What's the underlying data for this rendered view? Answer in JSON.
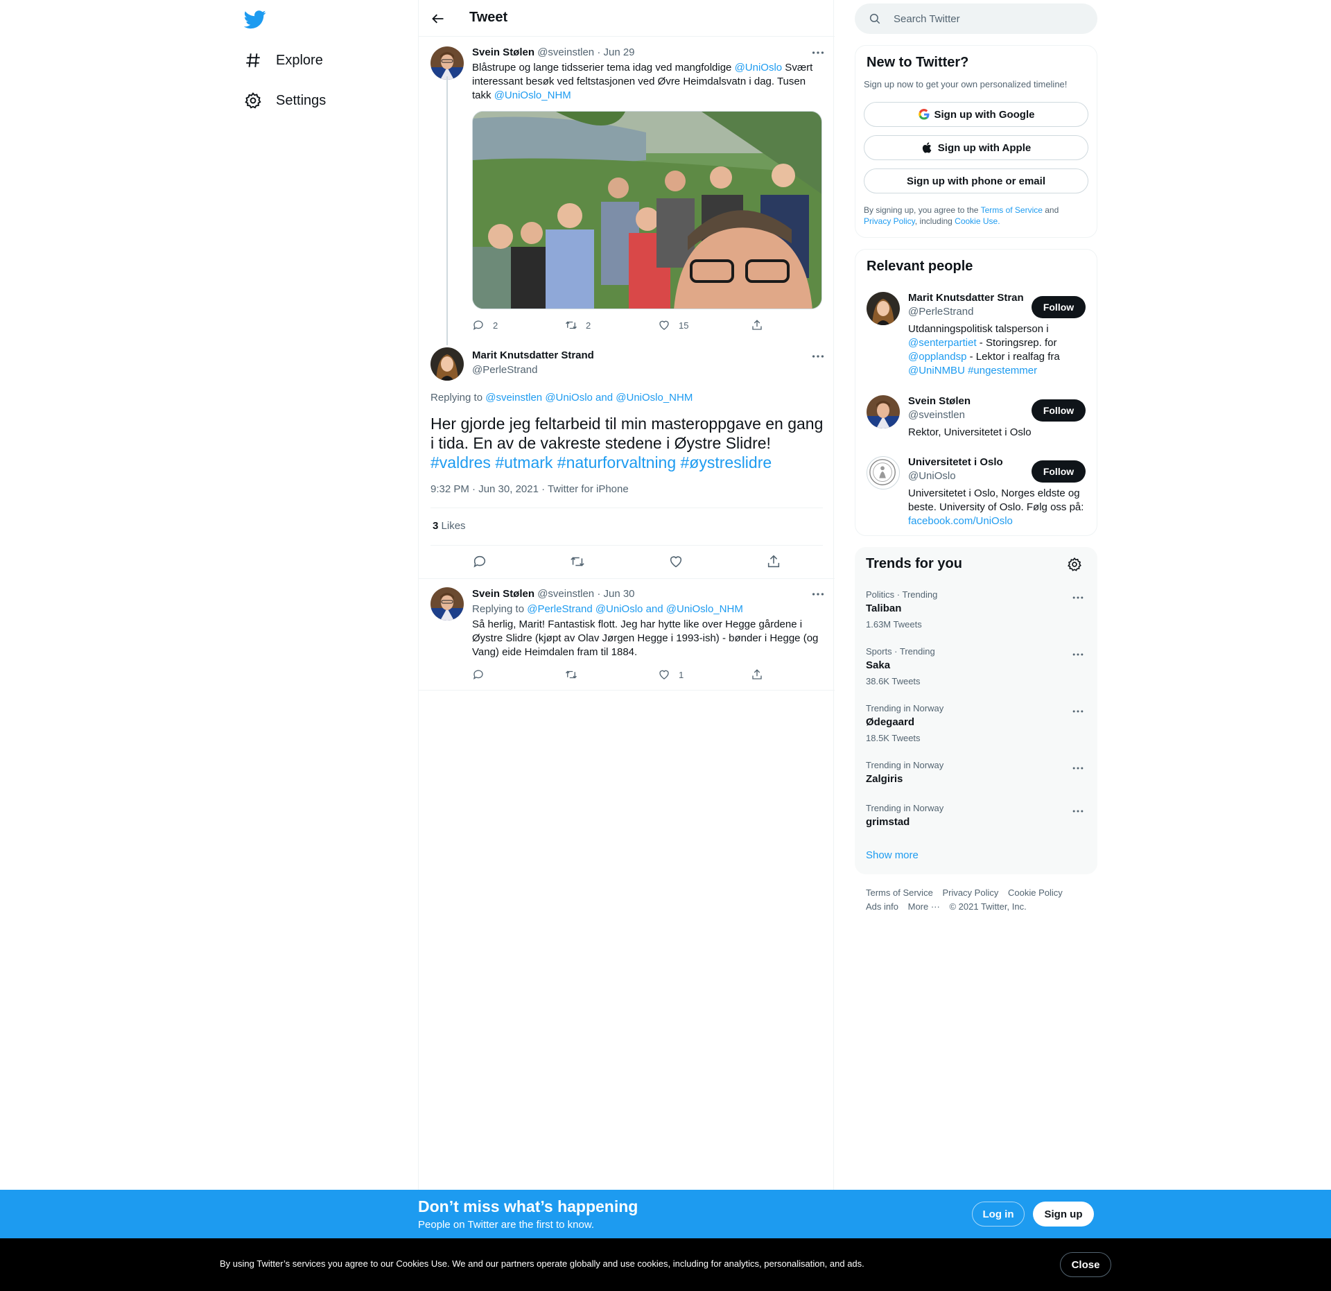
{
  "nav": {
    "logo_icon": "twitter-bird-icon",
    "items": [
      {
        "label": "Explore",
        "icon": "hashtag-icon"
      },
      {
        "label": "Settings",
        "icon": "gear-icon"
      }
    ]
  },
  "header": {
    "title": "Tweet",
    "back_icon": "arrow-left-icon"
  },
  "tweet1": {
    "author": "Svein Stølen",
    "handle": "@sveinstlen",
    "date": "· Jun 29",
    "text_parts": [
      "Blåstrupe og lange tidsserier tema idag ved mangfoldige ",
      "@UniOslo",
      " Svært interessant besøk ved feltstasjonen ved Øvre Heimdalsvatn i dag. Tusen takk ",
      "@UniOslo_NHM"
    ],
    "replies": "2",
    "retweets": "2",
    "likes": "15"
  },
  "focus": {
    "author": "Marit Knutsdatter Strand",
    "handle": "@PerleStrand",
    "replying_prefix": "Replying to ",
    "replying_to": "@sveinstlen @UniOslo and @UniOslo_NHM",
    "text": "Her gjorde jeg feltarbeid til min masteroppgave en gang i tida. En av de vakreste stedene i Øystre Slidre!",
    "hashtags": "#valdres #utmark #naturforvaltning #øystreslidre",
    "timestamp": "9:32 PM · Jun 30, 2021 · Twitter for iPhone",
    "likes_count": "3",
    "likes_label": "Likes"
  },
  "reply": {
    "author": "Svein Stølen",
    "handle": "@sveinstlen",
    "date": "· Jun 30",
    "replying_prefix": "Replying to ",
    "replying_to": "@PerleStrand @UniOslo and @UniOslo_NHM",
    "text": "Så herlig, Marit! Fantastisk flott. Jeg har hytte like over Hegge gårdene i Øystre Slidre (kjøpt av Olav Jørgen Hegge i 1993-ish) - bønder i Hegge (og Vang) eide Heimdalen fram til 1884.",
    "replies": "",
    "retweets": "",
    "likes": "1"
  },
  "search": {
    "placeholder": "Search Twitter"
  },
  "new_to_twitter": {
    "title": "New to Twitter?",
    "subtitle": "Sign up now to get your own personalized timeline!",
    "google": "Sign up with Google",
    "apple": "Sign up with Apple",
    "phone": "Sign up with phone or email",
    "legal_1": "By signing up, you agree to the ",
    "terms": "Terms of Service",
    "legal_2": " and",
    "privacy": "Privacy Policy",
    "legal_3": ", including ",
    "cookie": "Cookie Use."
  },
  "relevant": {
    "title": "Relevant people",
    "follow_label": "Follow",
    "people": [
      {
        "name": "Marit Knutsdatter Strand",
        "handle": "@PerleStrand",
        "bio_parts": [
          "Utdanningspolitisk talsperson i ",
          "@senterpartiet",
          " - Storingsrep. for ",
          "@opplandsp",
          " - Lektor i realfag fra ",
          "@UniNMBU #ungestemmer"
        ]
      },
      {
        "name": "Svein Stølen",
        "handle": "@sveinstlen",
        "bio_parts": [
          "Rektor, Universitetet i Oslo"
        ]
      },
      {
        "name": "Universitetet i Oslo",
        "handle": "@UniOslo",
        "bio_parts": [
          "Universitetet i Oslo, Norges eldste og beste. University of Oslo. Følg oss på: ",
          "facebook.com/UniOslo"
        ]
      }
    ]
  },
  "trends": {
    "title": "Trends for you",
    "items": [
      {
        "context": "Politics · Trending",
        "name": "Taliban",
        "count": "1.63M Tweets"
      },
      {
        "context": "Sports · Trending",
        "name": "Saka",
        "count": "38.6K Tweets"
      },
      {
        "context": "Trending in Norway",
        "name": "Ødegaard",
        "count": "18.5K Tweets"
      },
      {
        "context": "Trending in Norway",
        "name": "Zalgiris",
        "count": ""
      },
      {
        "context": "Trending in Norway",
        "name": "grimstad",
        "count": ""
      }
    ],
    "show_more": "Show more"
  },
  "footer": {
    "links": [
      "Terms of Service",
      "Privacy Policy",
      "Cookie Policy",
      "Ads info",
      "More ···"
    ],
    "copyright": "© 2021 Twitter, Inc."
  },
  "signup_bar": {
    "title": "Don’t miss what’s happening",
    "subtitle": "People on Twitter are the first to know.",
    "login": "Log in",
    "signup": "Sign up"
  },
  "cookie_bar": {
    "text": "By using Twitter’s services you agree to our Cookies Use. We and our partners operate globally and use cookies, including for analytics, personalisation, and ads.",
    "close": "Close"
  },
  "colors": {
    "accent": "#1d9bf0",
    "text": "#0f1419",
    "muted": "#536471"
  }
}
